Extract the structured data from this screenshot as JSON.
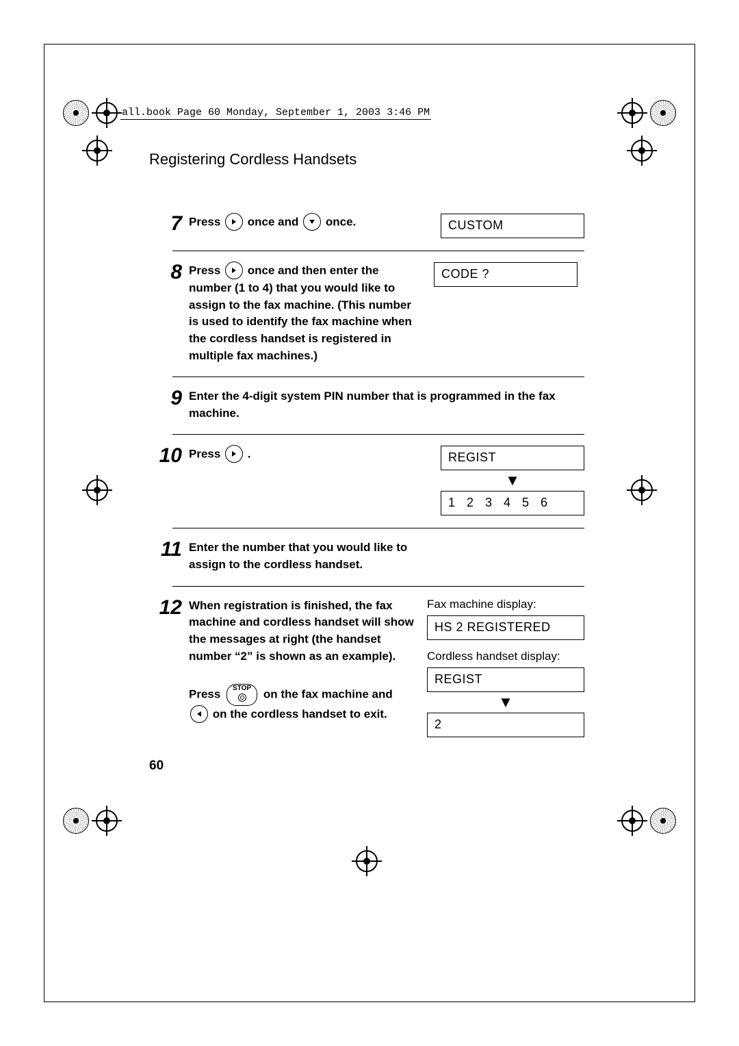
{
  "crop_info": "all.book  Page 60  Monday, September 1, 2003  3:46 PM",
  "section_title": "Registering Cordless Handsets",
  "page_number": "60",
  "steps": {
    "s7": {
      "num": "7",
      "text_a": "Press ",
      "text_b": " once and ",
      "text_c": " once.",
      "display": "CUSTOM"
    },
    "s8": {
      "num": "8",
      "text_a": "Press ",
      "text_b": " once and then enter the number (1 to 4) that you would like to assign to the fax machine. (This number is used to identify the fax machine when the cordless handset is registered in multiple fax machines.)",
      "display": "CODE ?"
    },
    "s9": {
      "num": "9",
      "text": "Enter the 4-digit system PIN number that is programmed in the fax machine."
    },
    "s10": {
      "num": "10",
      "text_a": "Press ",
      "text_b": " .",
      "display1": "REGIST",
      "display2": "1  2  3  4  5  6"
    },
    "s11": {
      "num": "11",
      "text": "Enter the number that you would like to assign to the cordless handset."
    },
    "s12": {
      "num": "12",
      "text": "When registration is finished, the fax machine and cordless handset will show the messages at right (the handset number “2” is shown as an example).",
      "press_a": "Press ",
      "press_b": " on the fax machine and ",
      "press_c": " on the cordless handset to exit.",
      "fax_label": "Fax machine display:",
      "fax_display": "HS 2 REGISTERED",
      "hs_label": "Cordless handset display:",
      "hs_display1": "REGIST",
      "hs_display2": "2"
    }
  },
  "icons": {
    "right": "right-arrow-icon",
    "down": "down-arrow-icon",
    "left": "left-arrow-icon",
    "stop": "STOP"
  }
}
